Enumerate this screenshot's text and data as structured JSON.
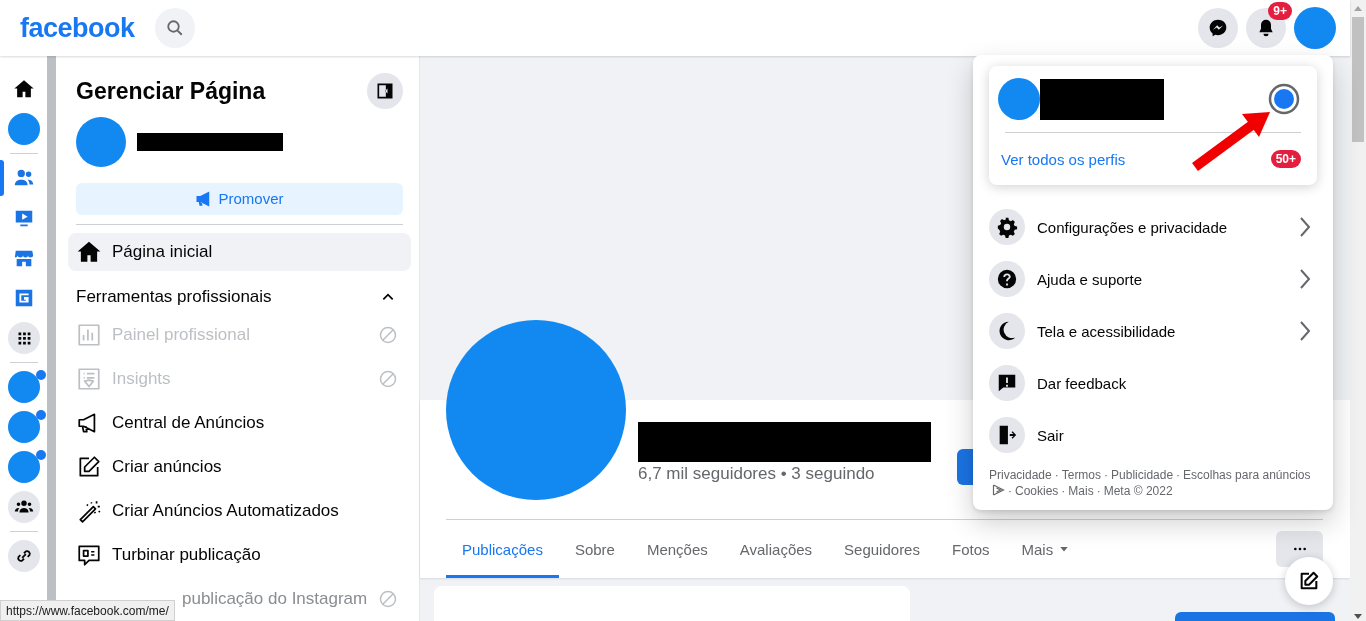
{
  "topbar": {
    "logo": "facebook",
    "notification_badge": "9+"
  },
  "rail": {
    "groups": [
      [
        {
          "kind": "home",
          "selected": false,
          "unread": false
        },
        {
          "kind": "avatar",
          "selected": false,
          "unread": false
        }
      ],
      [
        {
          "kind": "friends",
          "selected": true,
          "unread": false
        },
        {
          "kind": "watch",
          "selected": false,
          "unread": false
        },
        {
          "kind": "market",
          "selected": false,
          "unread": false
        },
        {
          "kind": "gaming",
          "selected": false,
          "unread": false
        },
        {
          "kind": "grid",
          "selected": false,
          "unread": false
        }
      ],
      [
        {
          "kind": "avatar",
          "selected": false,
          "unread": true
        },
        {
          "kind": "avatar",
          "selected": false,
          "unread": true
        },
        {
          "kind": "avatar",
          "selected": false,
          "unread": true
        },
        {
          "kind": "groups",
          "selected": false,
          "unread": false
        }
      ],
      [
        {
          "kind": "link",
          "selected": false,
          "unread": false
        }
      ]
    ]
  },
  "sidebar": {
    "title": "Gerenciar Página",
    "promote_button": "Promover",
    "home_item": {
      "label": "Página inicial",
      "selected": true
    },
    "section": {
      "title": "Ferramentas profissionais",
      "expanded": true,
      "items": [
        {
          "kind": "tool",
          "label": "Painel profissional",
          "disabled": true
        },
        {
          "kind": "tool",
          "label": "Insights",
          "disabled": true
        },
        {
          "kind": "tool",
          "label": "Central de Anúncios",
          "disabled": false
        },
        {
          "kind": "tool",
          "label": "Criar anúncios",
          "disabled": false
        },
        {
          "kind": "tool",
          "label": "Criar Anúncios Automatizados",
          "disabled": false
        },
        {
          "kind": "tool",
          "label": "Turbinar publicação",
          "disabled": false
        },
        {
          "kind": "cut",
          "label": "publicação do Instagram",
          "disabled": true
        }
      ]
    }
  },
  "profile": {
    "followers": "6,7 mil seguidores • 3 seguindo"
  },
  "tabs": [
    {
      "label": "Publicações",
      "selected": true,
      "dropdown": false
    },
    {
      "label": "Sobre",
      "selected": false,
      "dropdown": false
    },
    {
      "label": "Menções",
      "selected": false,
      "dropdown": false
    },
    {
      "label": "Avaliações",
      "selected": false,
      "dropdown": false
    },
    {
      "label": "Seguidores",
      "selected": false,
      "dropdown": false
    },
    {
      "label": "Fotos",
      "selected": false,
      "dropdown": false
    },
    {
      "label": "Mais",
      "selected": false,
      "dropdown": true
    }
  ],
  "account_menu": {
    "view_all_link": "Ver todos os perfis",
    "profiles_badge": "50+",
    "items": [
      {
        "label": "Configurações e privacidade",
        "submenu": true
      },
      {
        "label": "Ajuda e suporte",
        "submenu": true
      },
      {
        "label": "Tela e acessibilidade",
        "submenu": true
      },
      {
        "label": "Dar feedback",
        "submenu": false
      },
      {
        "label": "Sair",
        "submenu": false
      }
    ],
    "footer": {
      "separator": "·",
      "links": [
        "Privacidade",
        "Termos",
        "Publicidade",
        "Escolhas para anúncios",
        "Cookies",
        "Mais"
      ],
      "copyright": "Meta © 2022"
    }
  },
  "status_url": "https://www.facebook.com/me/"
}
